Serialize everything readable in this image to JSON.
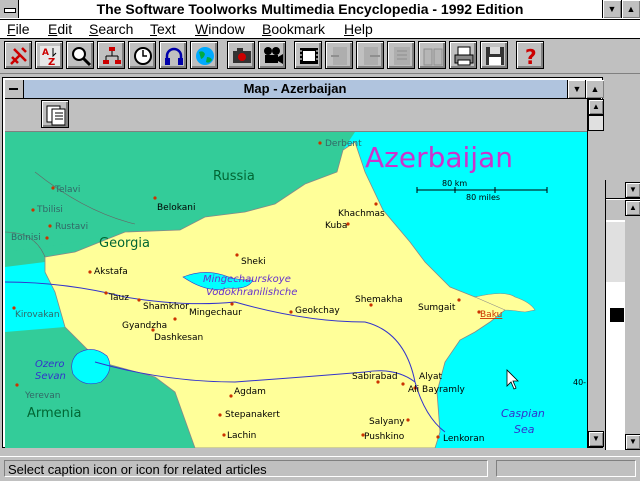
{
  "window": {
    "title": "The Software Toolworks Multimedia Encyclopedia - 1992 Edition"
  },
  "menu": [
    {
      "label": "File",
      "mnemonic": "F"
    },
    {
      "label": "Edit",
      "mnemonic": "E"
    },
    {
      "label": "Search",
      "mnemonic": "S"
    },
    {
      "label": "Text",
      "mnemonic": "T"
    },
    {
      "label": "Window",
      "mnemonic": "W"
    },
    {
      "label": "Bookmark",
      "mnemonic": "B"
    },
    {
      "label": "Help",
      "mnemonic": "H"
    }
  ],
  "toolbar": {
    "buttons": [
      {
        "icon": "tools-icon"
      },
      {
        "icon": "a-z-index-icon"
      },
      {
        "icon": "magnifier-search-icon"
      },
      {
        "icon": "tree-outline-icon"
      },
      {
        "icon": "clock-timeline-icon"
      },
      {
        "icon": "headphones-audio-icon"
      },
      {
        "icon": "globe-maps-icon"
      },
      {
        "icon": "camera-pictures-icon"
      },
      {
        "icon": "movie-camera-video-icon"
      },
      {
        "icon": "film-strip-icon"
      },
      {
        "icon": "prev-article-icon",
        "disabled": true
      },
      {
        "icon": "next-article-icon",
        "disabled": true
      },
      {
        "icon": "article-list-icon",
        "disabled": true
      },
      {
        "icon": "book-icon",
        "disabled": true
      },
      {
        "icon": "printer-icon"
      },
      {
        "icon": "floppy-save-icon"
      },
      {
        "icon": "help-question-icon"
      }
    ]
  },
  "child_window": {
    "title": "Map - Azerbaijan"
  },
  "map": {
    "title": "Azerbaijan",
    "scale": {
      "km": "80 km",
      "miles": "80 miles"
    },
    "latitude_label": "40-",
    "countries": [
      "Russia",
      "Georgia",
      "Armenia"
    ],
    "water": [
      "Mingechaurskoye Vodokhranilishche",
      "Ozero Sevan",
      "Caspian Sea"
    ],
    "cities": [
      "Derbent",
      "Telavi",
      "Tbilisi",
      "Rustavi",
      "Bolnisi",
      "Belokani",
      "Khachmas",
      "Kuba",
      "Sheki",
      "Akstafa",
      "Tauz",
      "Shamkhor",
      "Gyandzha",
      "Dashkesan",
      "Mingechaur",
      "Geokchay",
      "Shemakha",
      "Sumgait",
      "Baku",
      "Kirovakan",
      "Yerevan",
      "Sabirabad",
      "Alyat",
      "Ali Bayramly",
      "Agdam",
      "Stepanakert",
      "Salyany",
      "Pushkino",
      "Lachin",
      "Lenkoran"
    ]
  },
  "status": {
    "text": "Select caption icon or icon for related articles"
  },
  "colors": {
    "land_azerbaijan": "#ffff99",
    "land_other": "#33cc99",
    "water": "#00ffff",
    "city_dot": "#cc3300",
    "title_purple": "#cc33cc",
    "water_label": "#3333cc",
    "child_titlebar": "#b0c4de"
  }
}
